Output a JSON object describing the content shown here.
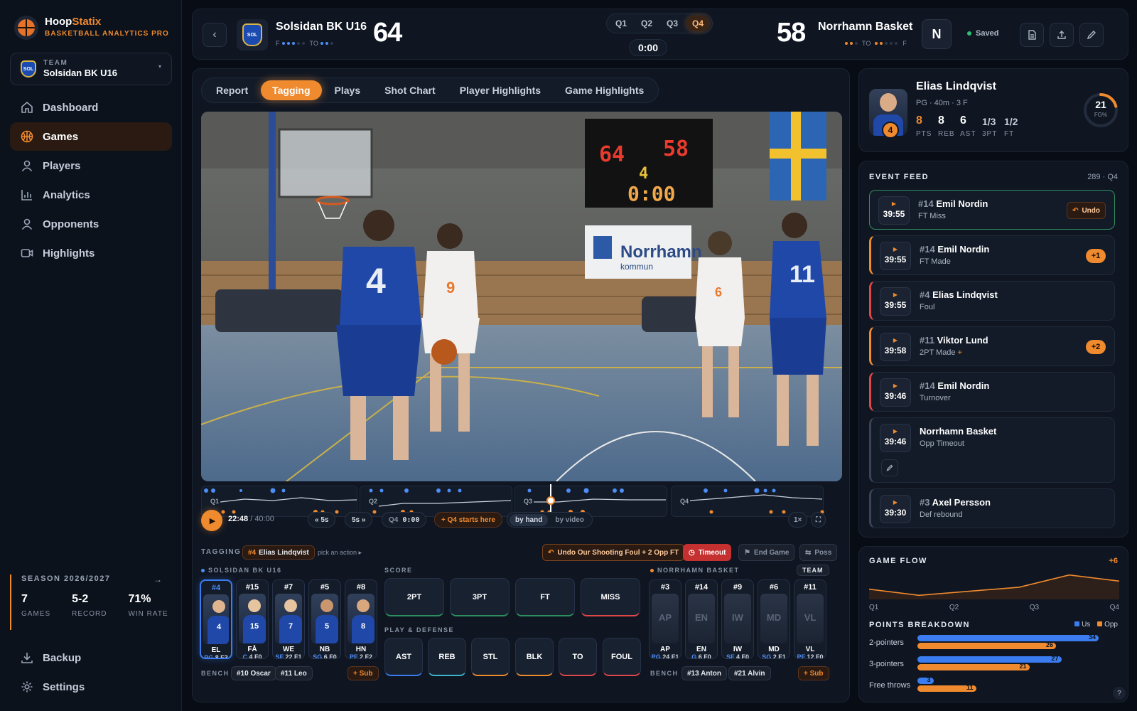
{
  "brand": {
    "name_a": "Hoop",
    "name_b": "Statix",
    "subtitle": "BASKETBALL ANALYTICS PRO"
  },
  "team_select": {
    "label": "TEAM",
    "name": "Solsidan BK U16",
    "badge": "SOL"
  },
  "nav": [
    {
      "label": "Dashboard",
      "icon": "home-icon"
    },
    {
      "label": "Games",
      "icon": "basketball-icon"
    },
    {
      "label": "Players",
      "icon": "user-icon"
    },
    {
      "label": "Analytics",
      "icon": "bar-chart-icon"
    },
    {
      "label": "Opponents",
      "icon": "user-icon"
    },
    {
      "label": "Highlights",
      "icon": "video-icon"
    }
  ],
  "season": {
    "title": "SEASON 2026/2027",
    "stats": [
      {
        "v": "7",
        "l": "GAMES"
      },
      {
        "v": "5-2",
        "l": "RECORD"
      },
      {
        "v": "71%",
        "l": "WIN RATE"
      }
    ]
  },
  "footer_nav": [
    {
      "label": "Backup",
      "icon": "download-icon"
    },
    {
      "label": "Settings",
      "icon": "gear-icon"
    }
  ],
  "header": {
    "home": {
      "name": "Solsidan BK U16",
      "score": "64",
      "f": "F",
      "to": "TO",
      "badge": "SOL"
    },
    "away": {
      "name": "Norrhamn Basket",
      "score": "58",
      "f": "F",
      "to": "TO",
      "badge": "N"
    },
    "quarters": [
      "Q1",
      "Q2",
      "Q3",
      "Q4"
    ],
    "active_quarter": "Q4",
    "clock": "0:00",
    "saved": "Saved"
  },
  "tabs": [
    "Report",
    "Tagging",
    "Plays",
    "Shot Chart",
    "Player Highlights",
    "Game Highlights"
  ],
  "video": {
    "scoreboard_home": "64",
    "scoreboard_away": "58",
    "scoreboard_period": "4",
    "scoreboard_clock": "0:00",
    "banner_text": "Norrhamn",
    "banner_sub": "kommun",
    "jersey_a": "4",
    "jersey_b": "11",
    "jersey_c": "9",
    "jersey_d": "6"
  },
  "timeline": {
    "segments": [
      "Q1",
      "Q2",
      "Q3",
      "Q4"
    ],
    "time": "22:48",
    "total": "/ 40:00",
    "back": "« 5s",
    "fwd": "5s »",
    "q_label": "Q4",
    "q_clock": "0:00",
    "q_start": "+ Q4 starts here",
    "by_hand": "by hand",
    "by_video": "by video",
    "speed": "1×",
    "progress": 0.56
  },
  "tagging": {
    "label": "TAGGING",
    "player_num": "#4",
    "player": "Elias Lindqvist",
    "hint": "pick an action ▸",
    "undo": "Undo Our Shooting Foul + 2 Opp FT",
    "timeout": "Timeout",
    "end_game": "End Game",
    "poss": "Poss"
  },
  "home_roster": {
    "title": "SOLSIDAN BK U16",
    "players": [
      {
        "num": "#4",
        "ini": "EL",
        "pos": "PG",
        "pts": "8",
        "f": "F3",
        "j": "4"
      },
      {
        "num": "#15",
        "ini": "FÅ",
        "pos": "C",
        "pts": "4",
        "f": "F0",
        "j": "15"
      },
      {
        "num": "#7",
        "ini": "WE",
        "pos": "SF",
        "pts": "22",
        "f": "F1",
        "j": "7"
      },
      {
        "num": "#5",
        "ini": "NB",
        "pos": "SG",
        "pts": "6",
        "f": "F0",
        "j": "5"
      },
      {
        "num": "#8",
        "ini": "HN",
        "pos": "PF",
        "pts": "2",
        "f": "F2",
        "j": "8"
      }
    ],
    "bench_label": "BENCH",
    "bench": [
      "#10 Oscar",
      "#11 Leo"
    ],
    "sub": "+ Sub"
  },
  "actions": {
    "score_label": "SCORE",
    "score": [
      "2PT",
      "3PT",
      "FT",
      "MISS"
    ],
    "pd_label": "PLAY & DEFENSE",
    "pd": [
      "AST",
      "REB",
      "STL",
      "BLK",
      "TO",
      "FOUL"
    ]
  },
  "away_roster": {
    "title": "NORRHAMN BASKET",
    "team_btn": "TEAM",
    "players": [
      {
        "num": "#3",
        "ini": "AP",
        "pos": "PG",
        "pts": "24",
        "f": "F1"
      },
      {
        "num": "#14",
        "ini": "EN",
        "pos": "G",
        "pts": "6",
        "f": "F0"
      },
      {
        "num": "#9",
        "ini": "IW",
        "pos": "SF",
        "pts": "4",
        "f": "F0"
      },
      {
        "num": "#6",
        "ini": "MD",
        "pos": "SG",
        "pts": "2",
        "f": "F1"
      },
      {
        "num": "#11",
        "ini": "VL",
        "pos": "PF",
        "pts": "12",
        "f": "F0"
      }
    ],
    "bench_label": "BENCH",
    "bench": [
      "#13 Anton",
      "#21 Alvin"
    ],
    "sub": "+ Sub"
  },
  "player_card": {
    "name": "Elias Lindqvist",
    "meta": "PG · 40m · 3 F",
    "jersey": "4",
    "stats": [
      {
        "v": "8",
        "l": "PTS"
      },
      {
        "v": "8",
        "l": "REB"
      },
      {
        "v": "6",
        "l": "AST"
      },
      {
        "v": "1/3",
        "l": "3PT"
      },
      {
        "v": "1/2",
        "l": "FT"
      }
    ],
    "fg": "21",
    "fg_label": "FG%",
    "fg_value": 0.21
  },
  "feed": {
    "title": "EVENT FEED",
    "count": "289 · Q4",
    "undo": "Undo",
    "events": [
      {
        "time": "39:55",
        "num": "#14",
        "name": "Emil Nordin",
        "action": "FT Miss",
        "color": "#2e8f5e",
        "badge": ""
      },
      {
        "time": "39:55",
        "num": "#14",
        "name": "Emil Nordin",
        "action": "FT Made",
        "color": "#f08a2e",
        "badge": "+1"
      },
      {
        "time": "39:55",
        "num": "#4",
        "name": "Elias Lindqvist",
        "action": "Foul",
        "color": "#e04848",
        "badge": ""
      },
      {
        "time": "39:58",
        "num": "#11",
        "name": "Viktor Lund",
        "action": "2PT Made",
        "color": "#f08a2e",
        "badge": "+2"
      },
      {
        "time": "39:46",
        "num": "#14",
        "name": "Emil Nordin",
        "action": "Turnover",
        "color": "#e04848",
        "badge": ""
      },
      {
        "time": "39:46",
        "num": "",
        "name": "Norrhamn Basket",
        "action": "Opp Timeout",
        "color": "#3a4456",
        "badge": ""
      },
      {
        "time": "39:30",
        "num": "#3",
        "name": "Axel Persson",
        "action": "Def rebound",
        "color": "#3a4456",
        "badge": ""
      }
    ]
  },
  "game_flow": {
    "title": "GAME FLOW",
    "diff": "+6",
    "quarters": [
      "Q1",
      "Q2",
      "Q3",
      "Q4"
    ],
    "points": [
      2,
      -1,
      1,
      3,
      9,
      6
    ]
  },
  "breakdown": {
    "title": "POINTS BREAKDOWN",
    "legend_us": "Us",
    "legend_opp": "Opp",
    "rows": [
      {
        "label": "2-pointers",
        "us": 34,
        "opp": 26
      },
      {
        "label": "3-pointers",
        "us": 27,
        "opp": 21
      },
      {
        "label": "Free throws",
        "us": 3,
        "opp": 11
      }
    ],
    "max": 36
  },
  "colors": {
    "accent": "#f08a2e",
    "home": "#3b7df0",
    "danger": "#e04848",
    "success": "#2e8f5e"
  }
}
